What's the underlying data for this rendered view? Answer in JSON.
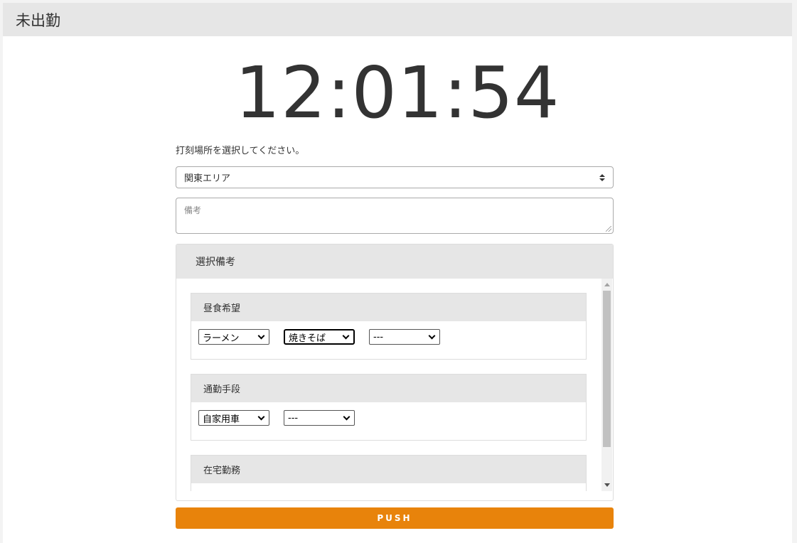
{
  "header": {
    "title": "未出勤"
  },
  "clock": {
    "time": "12:01:54"
  },
  "location": {
    "label": "打刻場所を選択してください。",
    "selected": "関東エリア"
  },
  "remarks": {
    "placeholder": "備考"
  },
  "selection_remarks": {
    "title": "選択備考",
    "groups": [
      {
        "title": "昼食希望",
        "selects": [
          "ラーメン",
          "焼きそば",
          "---"
        ]
      },
      {
        "title": "通勤手段",
        "selects": [
          "自家用車",
          "---"
        ]
      },
      {
        "title": "在宅勤務",
        "selects": [
          ""
        ]
      }
    ]
  },
  "push_button": {
    "label": "PUSH"
  },
  "colors": {
    "accent": "#e8830b",
    "header_bg": "#e6e6e6"
  }
}
